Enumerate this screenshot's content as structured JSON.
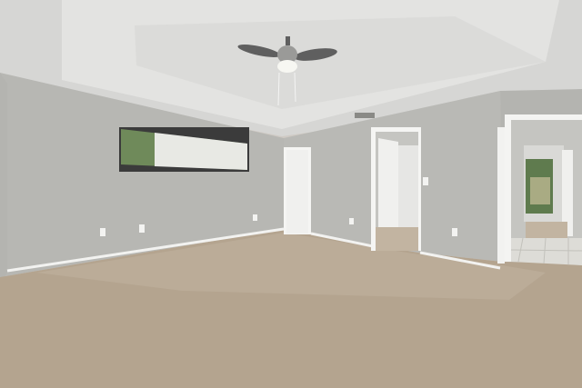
{
  "scene": {
    "palette": {
      "wall_left": "#b7b7b3",
      "wall_back": "#b9b9b5",
      "wall_right": "#b4b4b0",
      "ceiling": "#d6d6d4",
      "ceiling_tray": "#e3e3e1",
      "carpet": "#b4a48f",
      "carpet_far": "#c2b4a1",
      "baseboard": "#f2f2f0",
      "door_white": "#f0f0ee",
      "hall_wall": "#c5c5c1",
      "tile": "#dddcd7",
      "window_glass": "#6f8a5a",
      "blinds": "#eeeeec",
      "fan_blade": "#5f5f5f",
      "fan_light": "#f7f7f2"
    }
  }
}
